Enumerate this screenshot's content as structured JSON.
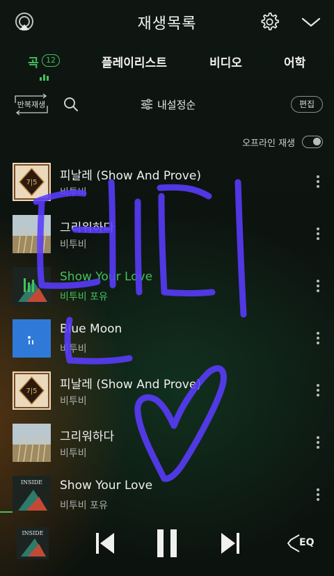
{
  "header": {
    "title": "재생목록",
    "icons": {
      "left": "cast-icon",
      "settings": "gear-icon",
      "collapse": "chevron-down-icon"
    }
  },
  "tabs": [
    {
      "label": "곡",
      "count": "12",
      "active": true
    },
    {
      "label": "플레이리스트"
    },
    {
      "label": "비디오"
    },
    {
      "label": "어학"
    }
  ],
  "controls": {
    "repeat_label": "반복재생",
    "sort_label": "내설정순",
    "edit_label": "편집"
  },
  "offline": {
    "label": "오프라인 재생",
    "enabled": false
  },
  "songs": [
    {
      "title": "피날레 (Show And Prove)",
      "artist": "비투비",
      "art": "finale"
    },
    {
      "title": "그리워하다",
      "artist": "비투비",
      "art": "field"
    },
    {
      "title": "Show Your Love",
      "artist": "비투비 포유",
      "art": "inside",
      "playing": true
    },
    {
      "title": "Blue Moon",
      "artist": "비투비",
      "art": "blue"
    },
    {
      "title": "피날레 (Show And Prove)",
      "artist": "비투비",
      "art": "finale"
    },
    {
      "title": "그리워하다",
      "artist": "비투비",
      "art": "field"
    },
    {
      "title": "Show Your Love",
      "artist": "비투비 포유",
      "art": "inside"
    }
  ],
  "player": {
    "state": "playing",
    "eq_label": "EQ",
    "album_art_text": "INSIDE"
  },
  "colors": {
    "accent": "#45c05b",
    "scribble": "#5a3cff"
  }
}
